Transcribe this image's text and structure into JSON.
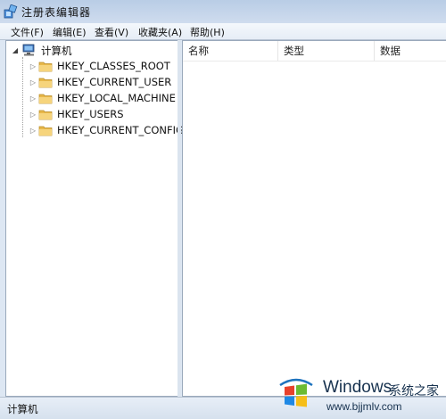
{
  "window": {
    "title": "注册表编辑器",
    "icon": "regedit-icon"
  },
  "menubar": {
    "items": [
      {
        "label": "文件(F)"
      },
      {
        "label": "编辑(E)"
      },
      {
        "label": "查看(V)"
      },
      {
        "label": "收藏夹(A)"
      },
      {
        "label": "帮助(H)"
      }
    ]
  },
  "tree": {
    "root": {
      "label": "计算机",
      "icon": "computer-icon",
      "expanded": true
    },
    "children": [
      {
        "label": "HKEY_CLASSES_ROOT",
        "icon": "folder-icon"
      },
      {
        "label": "HKEY_CURRENT_USER",
        "icon": "folder-icon"
      },
      {
        "label": "HKEY_LOCAL_MACHINE",
        "icon": "folder-icon"
      },
      {
        "label": "HKEY_USERS",
        "icon": "folder-icon"
      },
      {
        "label": "HKEY_CURRENT_CONFIG",
        "icon": "folder-icon"
      }
    ]
  },
  "list": {
    "columns": [
      {
        "label": "名称"
      },
      {
        "label": "类型"
      },
      {
        "label": "数据"
      }
    ]
  },
  "statusbar": {
    "text": "计算机"
  },
  "watermark": {
    "brand": "Windows",
    "cn_text": "系统之家",
    "url": "www.bjjmlv.com"
  },
  "colors": {
    "folder": "#e8b84a",
    "accent": "#1e4f86"
  }
}
